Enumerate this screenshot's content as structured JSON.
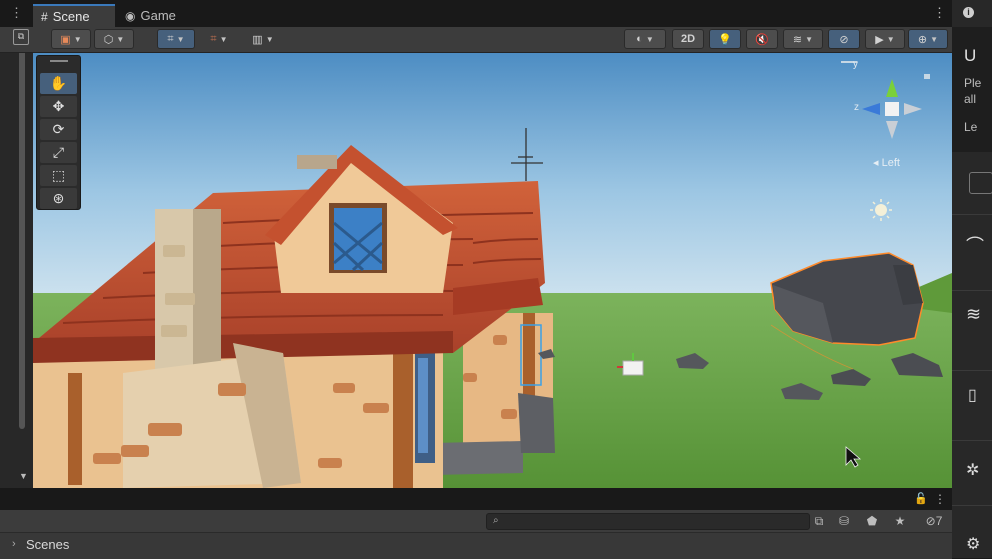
{
  "tabs": {
    "scene": "Scene",
    "game": "Game"
  },
  "toolbar": {
    "mode_2d": "2D"
  },
  "gizmo": {
    "x_label": "z",
    "y_label": "y",
    "view_label": "Left"
  },
  "hierarchy": {
    "visibility_count": "7",
    "scenes_label": "Scenes"
  },
  "right_panel": {
    "text_a": "U",
    "text_b": "Ple",
    "text_c": "all",
    "text_d": "Le"
  },
  "colors": {
    "accent": "#3a79bb",
    "selection_outline": "#ff8a2a",
    "sky_top": "#4f8fc4",
    "grass": "#5c9a3c"
  }
}
